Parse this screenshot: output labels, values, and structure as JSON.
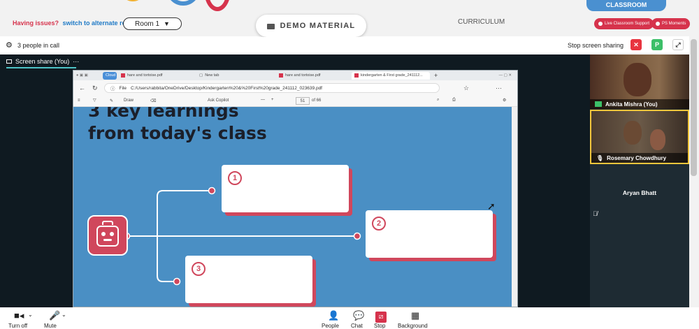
{
  "header": {
    "issues_text": "Having issues?",
    "alt_room_link": "switch to alternate room",
    "room_select": "Room 1",
    "demo_button": "DEMO MATERIAL",
    "curriculum_tab": "CURRICULUM",
    "classroom_tab": "CLASSROOM",
    "live_support": "Live Classroom Support",
    "ps_moments": "PS Moments"
  },
  "call": {
    "people_count": "3 people in call",
    "stop_share": "Stop screen sharing",
    "avatar_letter": "P"
  },
  "share": {
    "label": "Screen share (You)"
  },
  "browser": {
    "tabs": [
      {
        "label": "Cloud"
      },
      {
        "label": "hare and tortoise.pdf"
      },
      {
        "label": "New tab"
      },
      {
        "label": "hare and tortoise.pdf"
      },
      {
        "label": "kindergarten & First grade_241112..."
      }
    ],
    "file_label": "File",
    "url": "C:/Users/rabbita/OneDrive/Desktop/Kindergarten%20&%20First%20grade_241112_023639.pdf",
    "pdf_draw": "Draw",
    "pdf_ask": "Ask Copilot",
    "page_num": "51",
    "page_total": "of 66"
  },
  "slide": {
    "title": "3 key learnings\nfrom today's class",
    "cards": [
      "1",
      "2",
      "3"
    ]
  },
  "participants": [
    {
      "name": "Ankita Mishra (You)"
    },
    {
      "name": "Rosemary Chowdhury"
    },
    {
      "name": "Aryan Bhatt"
    }
  ],
  "bottom": {
    "items": [
      "Turn off",
      "Mute",
      "People",
      "Chat",
      "Stop",
      "Background"
    ]
  },
  "colors": {
    "accent_red": "#d6334c",
    "slide_blue": "#4a8fc4",
    "card_shadow": "#d0475c",
    "panel": "#1e2b33"
  }
}
